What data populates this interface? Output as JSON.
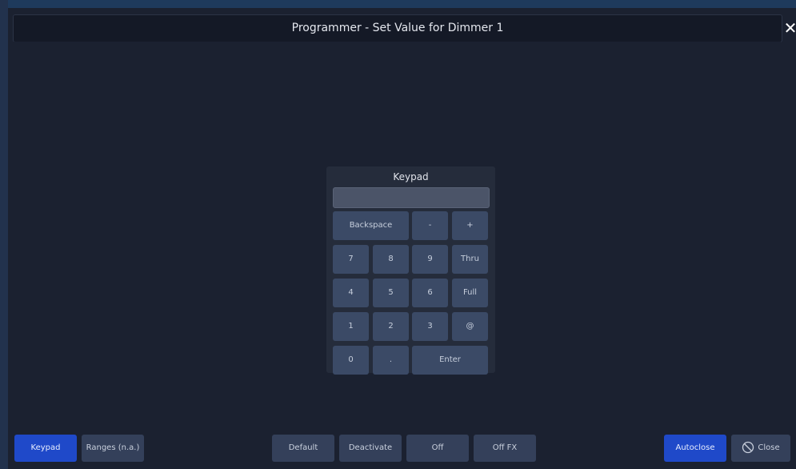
{
  "window": {
    "title": "Programmer - Set Value for Dimmer 1",
    "close_glyph": "✕"
  },
  "keypad": {
    "title": "Keypad",
    "display_value": "",
    "keys": {
      "backspace": "Backspace",
      "minus": "-",
      "plus": "+",
      "k7": "7",
      "k8": "8",
      "k9": "9",
      "thru": "Thru",
      "k4": "4",
      "k5": "5",
      "k6": "6",
      "full": "Full",
      "k1": "1",
      "k2": "2",
      "k3": "3",
      "at": "@",
      "k0": "0",
      "dot": ".",
      "enter": "Enter"
    }
  },
  "bottom": {
    "keypad": "Keypad",
    "ranges": "Ranges (n.a.)",
    "default": "Default",
    "deactivate": "Deactivate",
    "off": "Off",
    "offfx": "Off FX",
    "autoclose": "Autoclose",
    "close": "Close"
  },
  "colors": {
    "accent": "#1f49c9",
    "button": "#34405a",
    "key": "#3b4a66",
    "background": "#1b2130"
  }
}
